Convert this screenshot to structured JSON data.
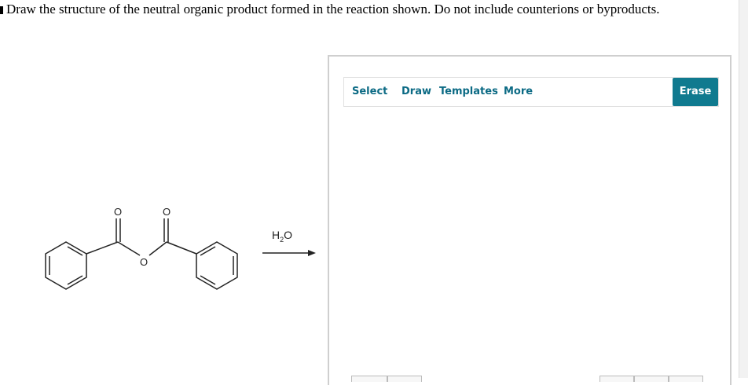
{
  "question": {
    "text": "Draw the structure of the neutral organic product formed in the reaction shown. Do not include counterions or byproducts."
  },
  "reaction": {
    "reagent_main": "H",
    "reagent_sub": "2",
    "reagent_tail": "O",
    "atom_label_oxygen": "O"
  },
  "toolbar": {
    "select_label": "Select",
    "draw_label": "Draw",
    "templates_label": "Templates",
    "more_label": "More",
    "erase_label": "Erase"
  },
  "colors": {
    "accent": "#107a8f",
    "tool_text": "#0b6a84"
  }
}
